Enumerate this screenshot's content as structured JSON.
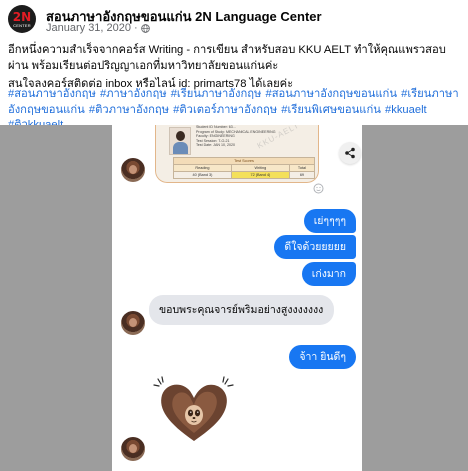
{
  "post": {
    "page_name": "สอนภาษาอังกฤษขอนแก่น 2N Language Center",
    "date": "January 31, 2020",
    "separator": "·",
    "logo_text": "2N",
    "logo_subtext": "CENTER",
    "line1": "อีกหนึ่งความสำเร็จจากคอร์ส Writing - การเขียน สำหรับสอบ KKU AELT ทำให้คุณแพรวสอบผ่าน พร้อมเรียนต่อปริญญาเอกที่มหาวิทยาลัยขอนแก่นค่ะ",
    "line2": "สนใจลงคอร์สติดต่อ inbox หรือไลน์ id: primarts78 ได้เลยค่ะ",
    "hashtags": [
      "#สอนภาษาอังกฤษ",
      "#ภาษาอังกฤษ",
      "#เรียนภาษาอังกฤษ",
      "#สอนภาษาอังกฤษขอนแก่น",
      "#เรียนภาษาอังกฤษขอนแก่น",
      "#ติวภาษาอังกฤษ",
      "#ติวเตอร์ภาษาอังกฤษ",
      "#เรียนพิเศษขอนแก่น",
      "#kkuaelt",
      "#ติวkkuaelt"
    ]
  },
  "chat": {
    "cert": {
      "lines": [
        "Student ID Number: 63...",
        "Program of Study: MECHANICAL ENGINEERING",
        "Faculty: ENGINEERING",
        "Test Session: T-O-21",
        "Test Date: JAN 10, 2020"
      ],
      "table_caption": "Test Scores",
      "headers": [
        "Reading",
        "Writing",
        "Total"
      ],
      "scores": [
        "40 (Band 3)",
        "72 (Band 4)",
        "69"
      ],
      "watermark": "KKU-AELT"
    },
    "outgoing": [
      {
        "text": "เย่ๆๆๆๆ"
      },
      {
        "text": "ดีใจด้วยยยยย"
      },
      {
        "text": "เก่งมาก"
      },
      {
        "text": "จ้าา ยินดีๆ"
      }
    ],
    "incoming": {
      "text": "ขอบพระคุณจารย์พริมอย่างสูงงงงงงง"
    },
    "colors": {
      "outgoing_bubble": "#1877f2",
      "incoming_bubble": "#e4e6eb",
      "hashtag": "#216fdb",
      "photo_background": "#9d9d9d"
    },
    "icons": [
      "share-icon",
      "add-reaction-icon",
      "heart-sloth-sticker"
    ]
  }
}
